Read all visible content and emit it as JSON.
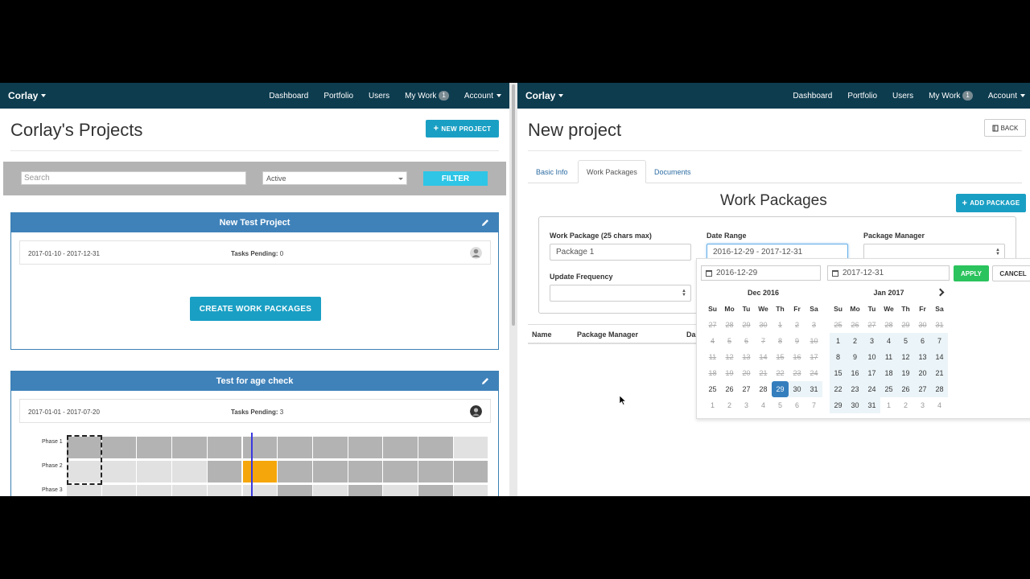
{
  "left": {
    "nav": {
      "brand": "Corlay",
      "links": [
        "Dashboard",
        "Portfolio",
        "Users",
        "My Work",
        "Account"
      ],
      "badge": "1"
    },
    "title": "Corlay's Projects",
    "new_project_label": "NEW PROJECT",
    "search_placeholder": "Search",
    "status_select": "Active",
    "filter_label": "FILTER",
    "cards": [
      {
        "title": "New Test Project",
        "dates": "2017-01-10 - 2017-12-31",
        "tasks_label": "Tasks Pending:",
        "tasks_value": "0",
        "button": "CREATE WORK PACKAGES"
      },
      {
        "title": "Test for age check",
        "dates": "2017-01-01 - 2017-07-20",
        "tasks_label": "Tasks Pending:",
        "tasks_value": "3"
      }
    ],
    "gantt": {
      "phases": [
        "Phase 1",
        "Phase 2",
        "Phase 3"
      ],
      "colors": {
        "dark": "#b3b3b3",
        "light": "#e1e1e1",
        "highlight": "#f5a60b",
        "today_line": "#3a3ae0"
      }
    }
  },
  "right": {
    "nav": {
      "brand": "Corlay",
      "links": [
        "Dashboard",
        "Portfolio",
        "Users",
        "My Work",
        "Account"
      ],
      "badge": "1"
    },
    "title": "New project",
    "back_label": "BACK",
    "tabs": [
      "Basic Info",
      "Work Packages",
      "Documents"
    ],
    "active_tab": "Work Packages",
    "section_title": "Work Packages",
    "add_package_label": "ADD PACKAGE",
    "form": {
      "package_label": "Work Package (25 chars max)",
      "package_value": "Package 1",
      "date_label": "Date Range",
      "date_value": "2016-12-29 - 2017-12-31",
      "manager_label": "Package Manager",
      "frequency_label": "Update Frequency"
    },
    "table_headers": [
      "Name",
      "Package Manager",
      "Da"
    ],
    "picker": {
      "start": "2016-12-29",
      "end": "2017-12-31",
      "apply": "APPLY",
      "cancel": "CANCEL",
      "dow": [
        "Su",
        "Mo",
        "Tu",
        "We",
        "Th",
        "Fr",
        "Sa"
      ],
      "months": [
        {
          "name": "Dec 2016",
          "days": [
            "27",
            "28",
            "29",
            "30",
            "1",
            "2",
            "3",
            "4",
            "5",
            "6",
            "7",
            "8",
            "9",
            "10",
            "11",
            "12",
            "13",
            "14",
            "15",
            "16",
            "17",
            "18",
            "19",
            "20",
            "21",
            "22",
            "23",
            "24",
            "25",
            "26",
            "27",
            "28",
            "29",
            "30",
            "31",
            "1",
            "2",
            "3",
            "4",
            "5",
            "6",
            "7"
          ]
        },
        {
          "name": "Jan 2017",
          "days": [
            "25",
            "26",
            "27",
            "28",
            "29",
            "30",
            "31",
            "1",
            "2",
            "3",
            "4",
            "5",
            "6",
            "7",
            "8",
            "9",
            "10",
            "11",
            "12",
            "13",
            "14",
            "15",
            "16",
            "17",
            "18",
            "19",
            "20",
            "21",
            "22",
            "23",
            "24",
            "25",
            "26",
            "27",
            "28",
            "29",
            "30",
            "31",
            "1",
            "2",
            "3",
            "4"
          ]
        }
      ]
    }
  }
}
